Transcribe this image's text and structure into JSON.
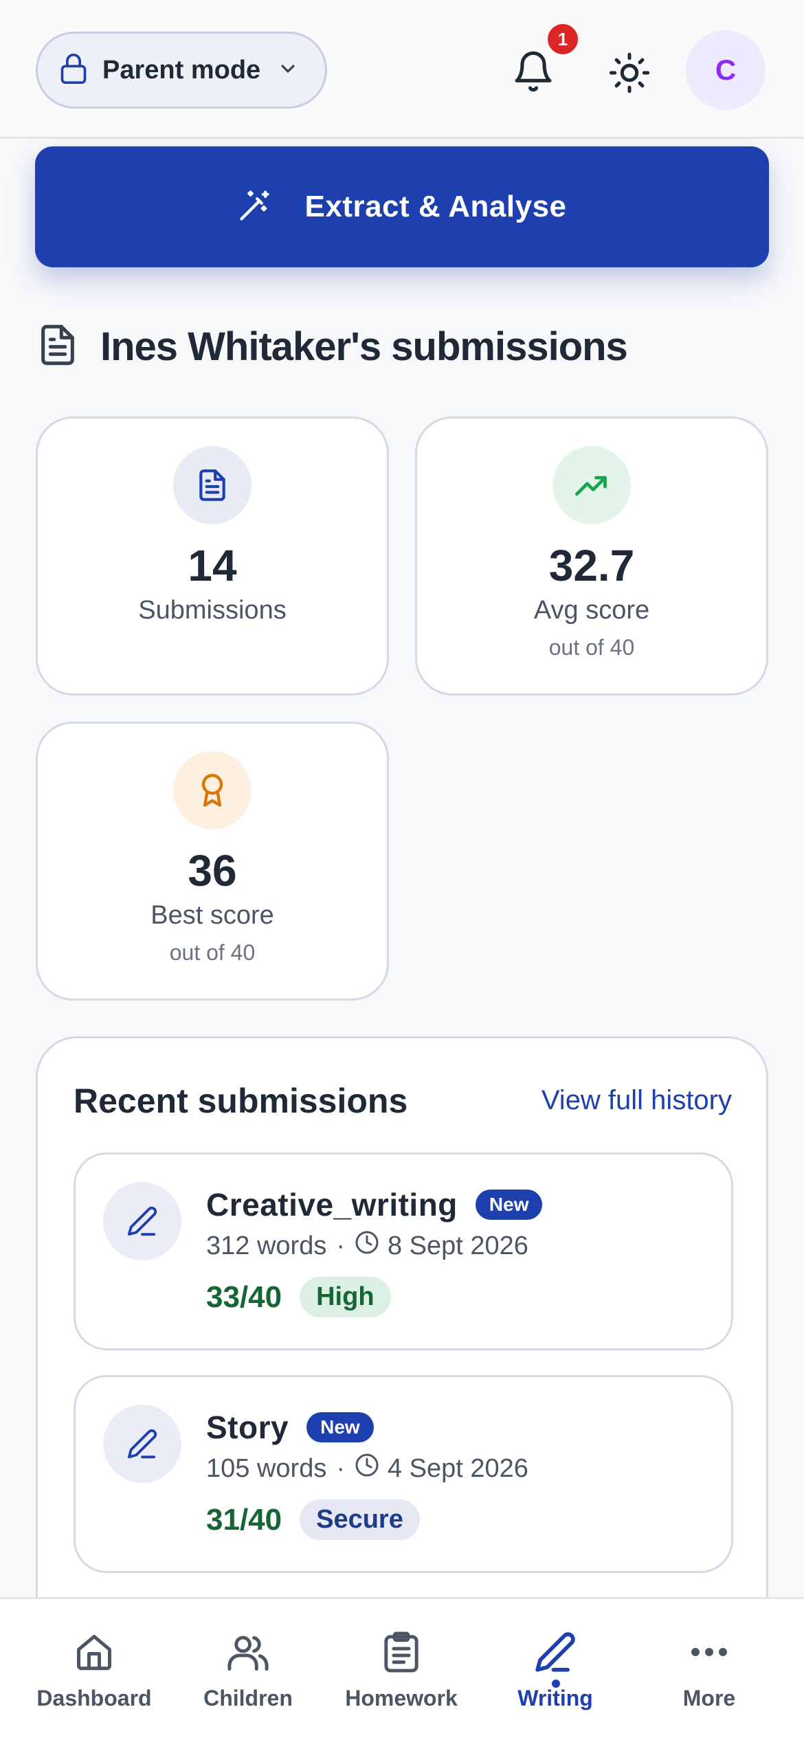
{
  "header": {
    "mode_label": "Parent mode",
    "notification_count": "1",
    "avatar_initial": "C"
  },
  "actions": {
    "extract_label": "Extract & Analyse"
  },
  "section": {
    "title": "Ines Whitaker's submissions"
  },
  "stats": [
    {
      "value": "14",
      "label": "Submissions",
      "sub": ""
    },
    {
      "value": "32.7",
      "label": "Avg score",
      "sub": "out of 40"
    },
    {
      "value": "36",
      "label": "Best score",
      "sub": "out of 40"
    }
  ],
  "recent": {
    "title": "Recent submissions",
    "view_all": "View full history",
    "items": [
      {
        "title": "Creative_writing",
        "badge": "New",
        "words": "312 words",
        "separator": "·",
        "date": "8 Sept 2026",
        "score": "33/40",
        "level": "High"
      },
      {
        "title": "Story",
        "badge": "New",
        "words": "105 words",
        "separator": "·",
        "date": "4 Sept 2026",
        "score": "31/40",
        "level": "Secure"
      }
    ]
  },
  "nav": {
    "items": [
      {
        "label": "Dashboard",
        "icon": "home-icon"
      },
      {
        "label": "Children",
        "icon": "users-icon"
      },
      {
        "label": "Homework",
        "icon": "clipboard-icon"
      },
      {
        "label": "Writing",
        "icon": "pen-icon",
        "active": true
      },
      {
        "label": "More",
        "icon": "more-icon"
      }
    ]
  },
  "colors": {
    "primary": "#1e40af",
    "success": "#166534",
    "badge_red": "#dc2626",
    "avatar_purple": "#8b2cf5"
  }
}
